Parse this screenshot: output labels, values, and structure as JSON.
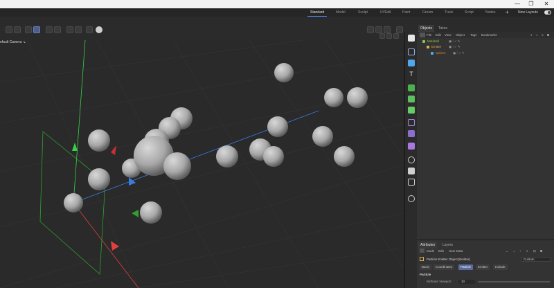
{
  "window": {
    "minimize": "—",
    "maximize": "❐",
    "close": "✕"
  },
  "layouts": {
    "tabs": [
      "Standard",
      "Model",
      "Sculpt",
      "UVEdit",
      "Paint",
      "Groom",
      "Track",
      "Script",
      "Nodes"
    ],
    "active": "Standard",
    "add": "+",
    "new_layouts": "New Layouts"
  },
  "viewport": {
    "camera_label": "efault Camera ↘"
  },
  "objects_panel": {
    "tabs": [
      "Objects",
      "Takes"
    ],
    "menu": [
      "File",
      "Edit",
      "View",
      "Object",
      "Tags",
      "Bookmarks"
    ],
    "tree": [
      {
        "name": "Metaball",
        "color": "#8fc24a"
      },
      {
        "name": "Emitter",
        "color": "#e0b050"
      },
      {
        "name": "Sphere",
        "color": "#d28b3a"
      }
    ]
  },
  "attributes_panel": {
    "tabs": [
      "Attributes",
      "Layers"
    ],
    "menu": [
      "Mode",
      "Edit",
      "User Data"
    ],
    "object_title": "Particle Emitter Object [Emitter]",
    "preset": "Custom",
    "section_tabs": [
      "Basic",
      "Coordinates",
      "Particle",
      "Emitter",
      "Include"
    ],
    "active_section": "Particle",
    "section_title": "Particle",
    "param_label": "Birthrate Viewport",
    "param_value": "10"
  },
  "colors": {
    "accent": "#5b8cff",
    "axis_x": "#e04040",
    "axis_y": "#3ad04a",
    "axis_z": "#3a7be0"
  }
}
